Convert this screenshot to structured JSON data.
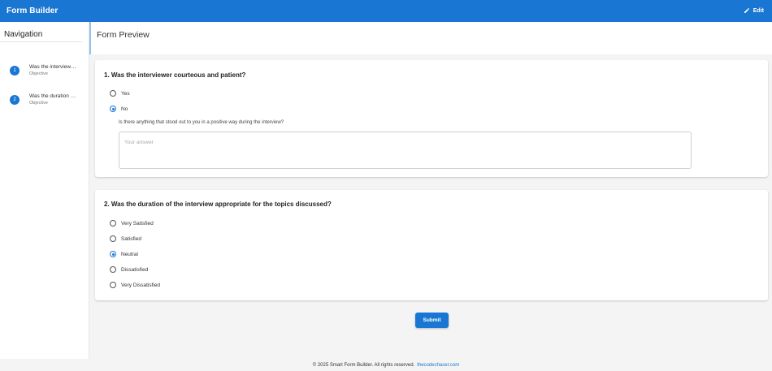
{
  "app": {
    "title": "Form Builder",
    "edit_label": "Edit"
  },
  "sidebar": {
    "title": "Navigation",
    "items": [
      {
        "number": "1",
        "label": "Was the interviewer courteous and patient?",
        "type": "Objective"
      },
      {
        "number": "2",
        "label": "Was the duration of the interview appropriate for the topics discussed?",
        "type": "Objective"
      }
    ]
  },
  "main": {
    "title": "Form Preview"
  },
  "questions": [
    {
      "title": "1. Was the interviewer courteous and patient?",
      "options": [
        "Yes",
        "No"
      ],
      "selected": "No",
      "followup_label": "Is there anything that stood out to you in a positive way during the interview?",
      "answer_placeholder": "Your answer",
      "answer_value": ""
    },
    {
      "title": "2. Was the duration of the interview appropriate for the topics discussed?",
      "options": [
        "Very Satisfied",
        "Satisfied",
        "Neutral",
        "Dissatisfied",
        "Very Dissatisfied"
      ],
      "selected": "Neutral"
    }
  ],
  "submit_label": "Submit",
  "footer": {
    "text": "© 2025 Smart Form Builder. All rights reserved.",
    "link": "thecodechaser.com"
  },
  "colors": {
    "primary": "#1976d2",
    "background": "#f4f4f4"
  },
  "icons": {
    "edit": "pencil-icon"
  }
}
